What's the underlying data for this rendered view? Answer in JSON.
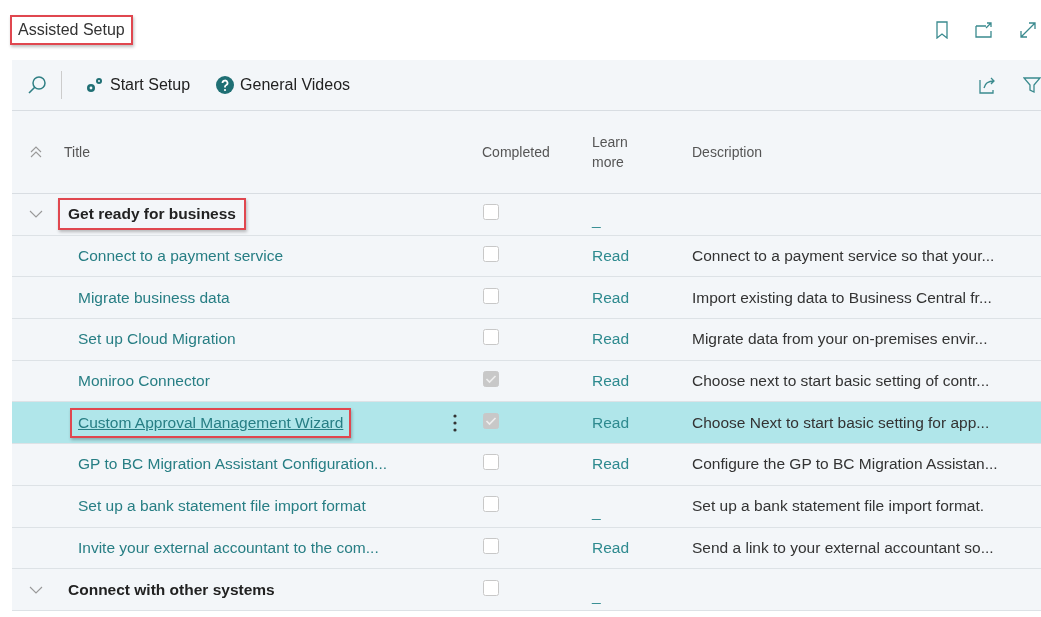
{
  "page_title": {
    "text": "Assisted Setup",
    "highlighted": true
  },
  "toolbar": {
    "actions": [
      {
        "kind": "setup",
        "label": "Start Setup"
      },
      {
        "kind": "help",
        "label": "General Videos"
      }
    ]
  },
  "table": {
    "columns": [
      {
        "label": "Title"
      },
      {
        "label": "Completed"
      },
      {
        "label": "Learn more"
      },
      {
        "label": "Description"
      }
    ],
    "rows": [
      {
        "kind": "group",
        "title": "Get ready for business",
        "highlighted": true,
        "expanded": true,
        "completed": false,
        "learn_more": "_",
        "description": "",
        "selected": false
      },
      {
        "kind": "item",
        "title": "Connect to a payment service",
        "highlighted": false,
        "completed": false,
        "learn_more": "Read",
        "description": "Connect to a payment service so that your...",
        "selected": false
      },
      {
        "kind": "item",
        "title": "Migrate business data",
        "highlighted": false,
        "completed": false,
        "learn_more": "Read",
        "description": "Import existing data to Business Central fr...",
        "selected": false
      },
      {
        "kind": "item",
        "title": "Set up Cloud Migration",
        "highlighted": false,
        "completed": false,
        "learn_more": "Read",
        "description": "Migrate data from your on-premises envir...",
        "selected": false
      },
      {
        "kind": "item",
        "title": "Moniroo Connector",
        "highlighted": false,
        "completed": true,
        "learn_more": "Read",
        "description": "Choose next to start basic setting of contr...",
        "selected": false
      },
      {
        "kind": "item",
        "title": "Custom Approval Management Wizard",
        "highlighted": true,
        "completed": true,
        "learn_more": "Read",
        "description": "Choose Next to start basic setting for app...",
        "selected": true
      },
      {
        "kind": "item",
        "title": "GP to BC Migration Assistant Configuration...",
        "highlighted": false,
        "completed": false,
        "learn_more": "Read",
        "description": "Configure the GP to BC Migration Assistan...",
        "selected": false
      },
      {
        "kind": "item",
        "title": "Set up a bank statement file import format",
        "highlighted": false,
        "completed": false,
        "learn_more": "_",
        "description": "Set up a bank statement file import format.",
        "selected": false
      },
      {
        "kind": "item",
        "title": "Invite your external accountant to the com...",
        "highlighted": false,
        "completed": false,
        "learn_more": "Read",
        "description": "Send a link to your external accountant so...",
        "selected": false
      },
      {
        "kind": "group",
        "title": "Connect with other systems",
        "highlighted": false,
        "expanded": true,
        "completed": false,
        "learn_more": "_",
        "description": "",
        "selected": false
      }
    ]
  }
}
